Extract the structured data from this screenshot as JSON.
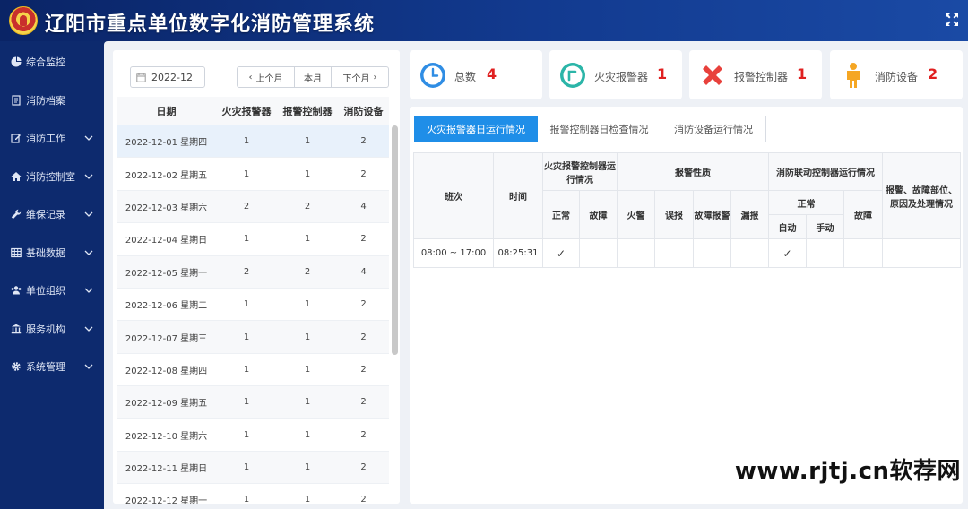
{
  "header": {
    "title": "辽阳市重点单位数字化消防管理系统"
  },
  "sidebar": {
    "items": [
      {
        "label": "综合监控",
        "icon": "pie-chart-icon",
        "expandable": false
      },
      {
        "label": "消防档案",
        "icon": "file-icon",
        "expandable": false
      },
      {
        "label": "消防工作",
        "icon": "edit-icon",
        "expandable": true
      },
      {
        "label": "消防控制室",
        "icon": "home-icon",
        "expandable": true
      },
      {
        "label": "维保记录",
        "icon": "wrench-icon",
        "expandable": true
      },
      {
        "label": "基础数据",
        "icon": "table-icon",
        "expandable": true
      },
      {
        "label": "单位组织",
        "icon": "users-icon",
        "expandable": true
      },
      {
        "label": "服务机构",
        "icon": "bank-icon",
        "expandable": true
      },
      {
        "label": "系统管理",
        "icon": "gear-icon",
        "expandable": true
      }
    ]
  },
  "filter": {
    "date_value": "2022-12",
    "prev_label": "上个月",
    "this_label": "本月",
    "next_label": "下个月"
  },
  "daily_table": {
    "headers": [
      "日期",
      "火灾报警器",
      "报警控制器",
      "消防设备"
    ],
    "rows": [
      {
        "date": "2022-12-01 星期四",
        "fire": "1",
        "ctrl": "1",
        "dev": "2"
      },
      {
        "date": "2022-12-02 星期五",
        "fire": "1",
        "ctrl": "1",
        "dev": "2"
      },
      {
        "date": "2022-12-03 星期六",
        "fire": "2",
        "ctrl": "2",
        "dev": "4"
      },
      {
        "date": "2022-12-04 星期日",
        "fire": "1",
        "ctrl": "1",
        "dev": "2"
      },
      {
        "date": "2022-12-05 星期一",
        "fire": "2",
        "ctrl": "2",
        "dev": "4"
      },
      {
        "date": "2022-12-06 星期二",
        "fire": "1",
        "ctrl": "1",
        "dev": "2"
      },
      {
        "date": "2022-12-07 星期三",
        "fire": "1",
        "ctrl": "1",
        "dev": "2"
      },
      {
        "date": "2022-12-08 星期四",
        "fire": "1",
        "ctrl": "1",
        "dev": "2"
      },
      {
        "date": "2022-12-09 星期五",
        "fire": "1",
        "ctrl": "1",
        "dev": "2"
      },
      {
        "date": "2022-12-10 星期六",
        "fire": "1",
        "ctrl": "1",
        "dev": "2"
      },
      {
        "date": "2022-12-11 星期日",
        "fire": "1",
        "ctrl": "1",
        "dev": "2"
      },
      {
        "date": "2022-12-12 星期一",
        "fire": "1",
        "ctrl": "1",
        "dev": "2"
      }
    ]
  },
  "summary": {
    "cards": [
      {
        "label": "总数",
        "value": "4",
        "icon": "clock-icon",
        "color": "#2f8de4"
      },
      {
        "label": "火灾报警器",
        "value": "1",
        "icon": "ring-icon",
        "color": "#2bb5a8"
      },
      {
        "label": "报警控制器",
        "value": "1",
        "icon": "close-icon",
        "color": "#e8413c"
      },
      {
        "label": "消防设备",
        "value": "2",
        "icon": "person-icon",
        "color": "#f5a623"
      }
    ]
  },
  "tabs": [
    "火灾报警器日运行情况",
    "报警控制器日检查情况",
    "消防设备运行情况"
  ],
  "report": {
    "h_shift": "班次",
    "h_time": "时间",
    "h_ctrl_status": "火灾报警控制器运行情况",
    "h_alarm_type": "报警性质",
    "h_linkage": "消防联动控制器运行情况",
    "h_remark": "报警、故障部位、原因及处理情况",
    "h_normal": "正常",
    "h_fault": "故障",
    "h_fire": "火警",
    "h_false": "误报",
    "h_fault_alarm": "故障报警",
    "h_missed": "漏报",
    "h_linkage_normal": "正常",
    "h_linkage_fault": "故障",
    "h_auto": "自动",
    "h_manual": "手动",
    "row": {
      "shift": "08:00 ~ 17:00",
      "time": "08:25:31",
      "ctrl_normal": "✓",
      "linkage_auto": "✓"
    }
  },
  "watermark": "www.rjtj.cn软荐网",
  "colors": {
    "header_bg": "#0d2a6e",
    "accent": "#1f8ee8",
    "value_red": "#e02020"
  }
}
